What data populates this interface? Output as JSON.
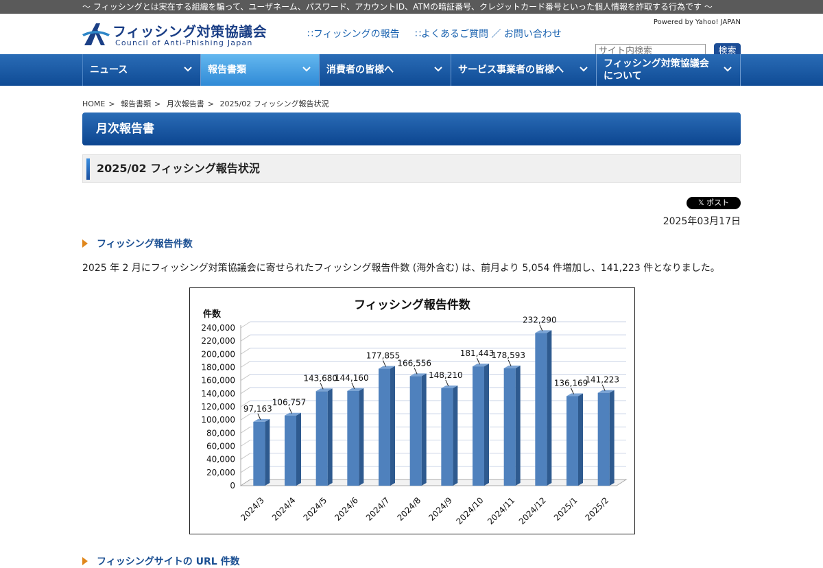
{
  "topbar": {
    "text": "～ フィッシングとは実在する組織を騙って、ユーザネーム、パスワード、アカウントID、ATMの暗証番号、クレジットカード番号といった個人情報を詐取する行為です ～"
  },
  "header": {
    "logo_jp": "フィッシング対策協議会",
    "logo_en": "Council of Anti-Phishing Japan",
    "links": [
      "∷フィッシングの報告",
      "∷よくあるご質問 ／ お問い合わせ"
    ],
    "powered": "Powered by Yahoo! JAPAN",
    "search_placeholder": "サイト内検索",
    "search_button": "検索"
  },
  "nav": {
    "items": [
      {
        "label": "ニュース",
        "active": false
      },
      {
        "label": "報告書類",
        "active": true
      },
      {
        "label": "消費者の皆様へ",
        "active": false
      },
      {
        "label": "サービス事業者の皆様へ",
        "active": false
      },
      {
        "label": "フィッシング対策協議会\nについて",
        "active": false
      }
    ]
  },
  "breadcrumb": [
    "HOME",
    "報告書類",
    "月次報告書",
    "2025/02 フィッシング報告状況"
  ],
  "section_title": "月次報告書",
  "page_title": "2025/02 フィッシング報告状況",
  "post_button": "𝕏 ポスト",
  "date": "2025年03月17日",
  "subheads": [
    "フィッシング報告件数",
    "フィッシングサイトの URL 件数"
  ],
  "paragraph": "2025 年 2 月にフィッシング対策協議会に寄せられたフィッシング報告件数 (海外含む) は、前月より 5,054 件増加し、141,223 件となりました。",
  "colors": {
    "nav": "#1c5aa5",
    "accent": "#e0871c",
    "bar": "#4f81bd"
  },
  "chart_data": {
    "type": "bar",
    "title": "フィッシング報告件数",
    "ylabel": "件数",
    "xlabel": "",
    "categories": [
      "2024/3",
      "2024/4",
      "2024/5",
      "2024/6",
      "2024/7",
      "2024/8",
      "2024/9",
      "2024/10",
      "2024/11",
      "2024/12",
      "2025/1",
      "2025/2"
    ],
    "values": [
      97163,
      106757,
      143680,
      144160,
      177855,
      166556,
      148210,
      181443,
      178593,
      232290,
      136169,
      141223
    ],
    "value_labels": [
      "97,163",
      "106,757",
      "143,680",
      "144,160",
      "177,855",
      "166,556",
      "148,210",
      "181,443",
      "178,593",
      "232,290",
      "136,169",
      "141,223"
    ],
    "yticks": [
      "0",
      "20,000",
      "40,000",
      "60,000",
      "80,000",
      "100,000",
      "120,000",
      "140,000",
      "160,000",
      "180,000",
      "200,000",
      "220,000",
      "240,000"
    ],
    "ylim": [
      0,
      240000
    ],
    "grid": true
  }
}
